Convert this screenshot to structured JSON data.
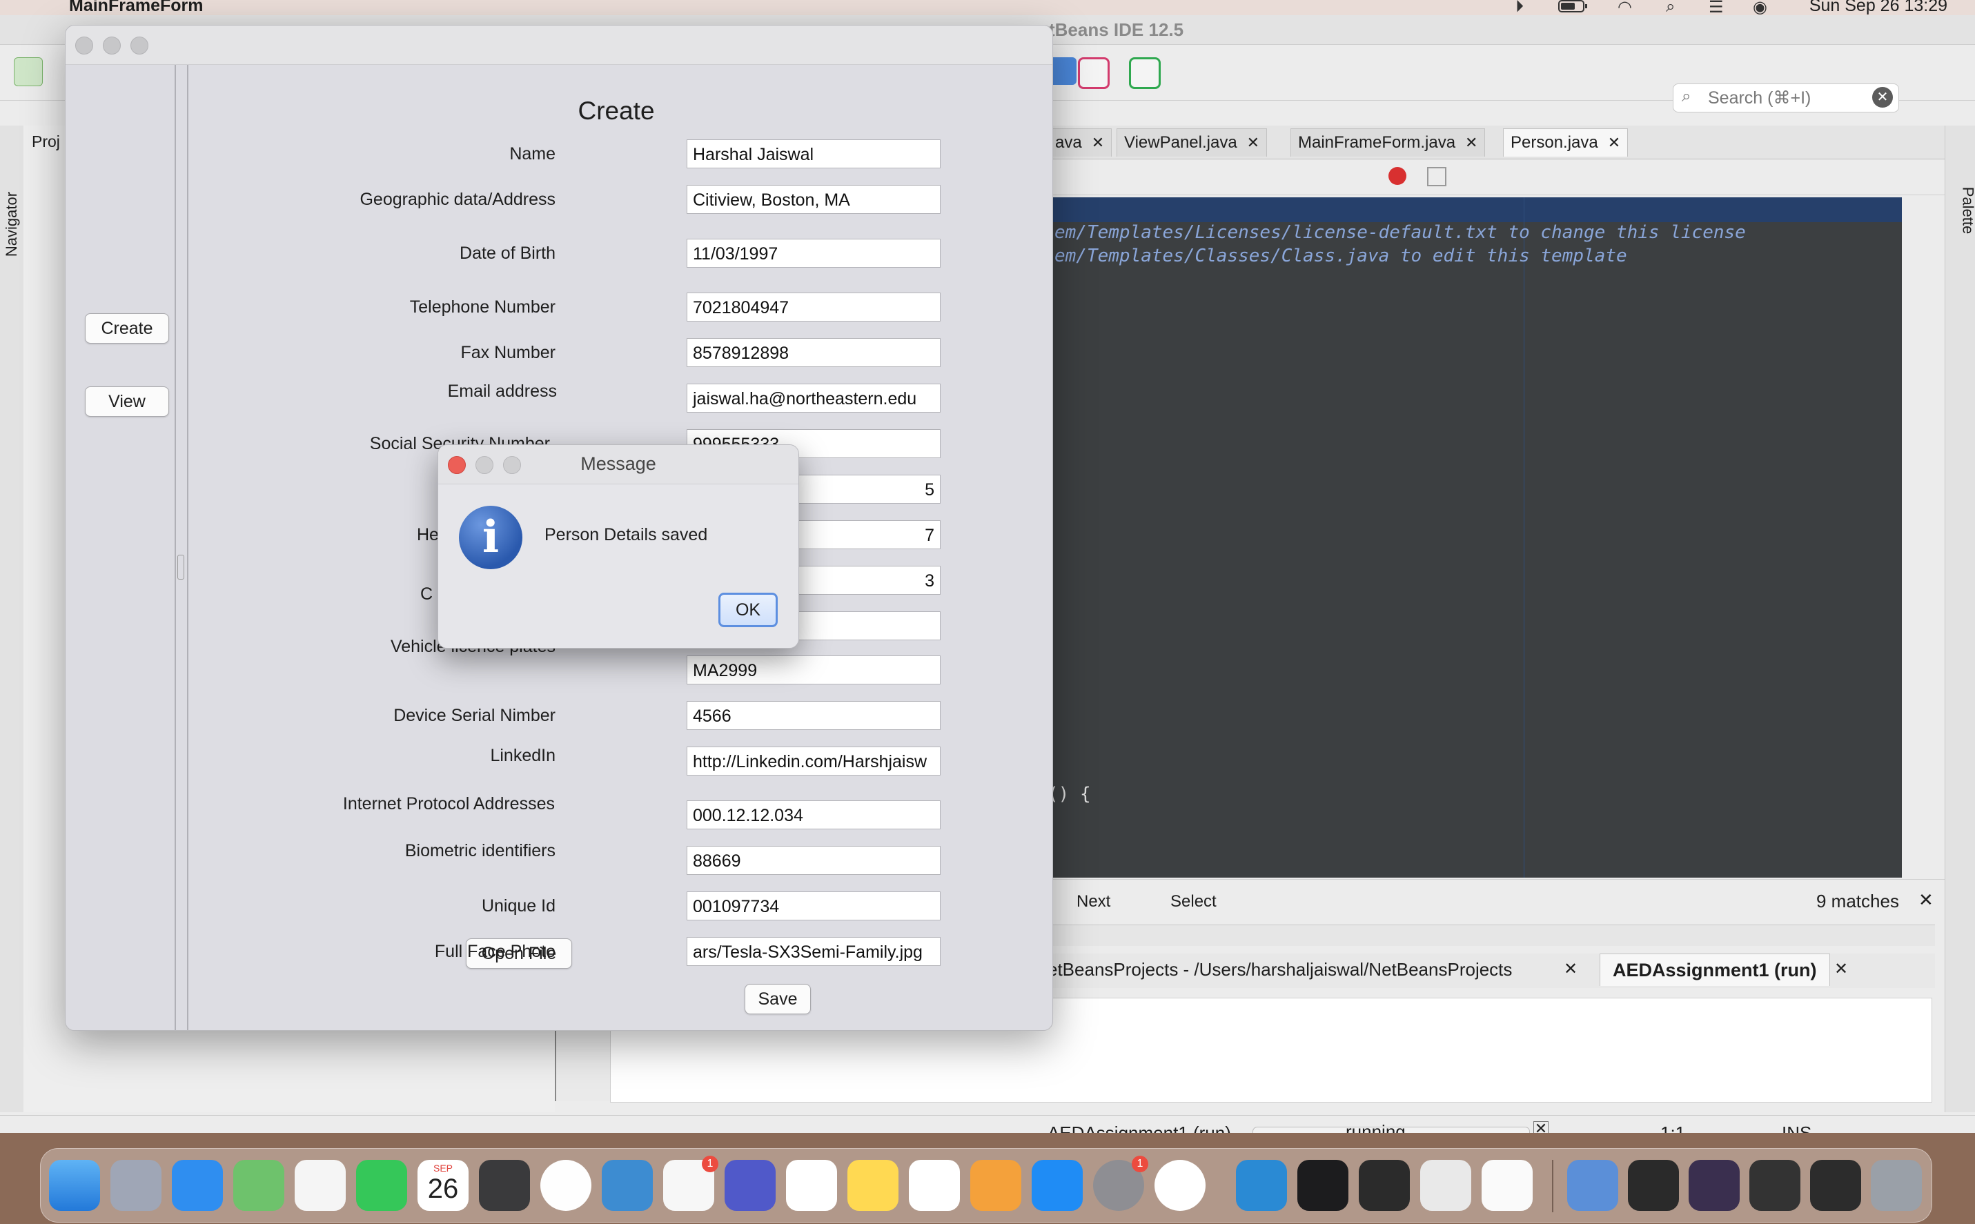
{
  "menubar": {
    "app_name": "MainFrameForm",
    "clock": "Sun Sep 26  13:29",
    "icons": [
      "apple-icon",
      "play-icon",
      "battery-icon",
      "wifi-icon",
      "search-icon",
      "control-center-icon",
      "siri-icon"
    ]
  },
  "ide": {
    "title": "tBeans IDE 12.5",
    "search_placeholder": "Search (⌘+I)",
    "left_panel_label": "Proj",
    "navigator_label": "Navigator",
    "palette_label": "Palette",
    "editor_tabs": [
      {
        "label": "ava"
      },
      {
        "label": "ViewPanel.java"
      },
      {
        "label": "MainFrameForm.java"
      },
      {
        "label": "Person.java"
      }
    ],
    "code_lines": [
      "em/Templates/Licenses/license-default.txt to change this license",
      "em/Templates/Classes/Class.java to edit this template",
      "() {"
    ],
    "findbar": {
      "next": "Next",
      "select": "Select",
      "matches": "9 matches"
    },
    "output_tabs": [
      {
        "label": "etBeansProjects - /Users/harshaljaiswal/NetBeansProjects"
      },
      {
        "label": "AEDAssignment1 (run)"
      }
    ],
    "status": {
      "task": "AEDAssignment1 (run)",
      "running": "running...",
      "position": "1:1",
      "mode": "INS"
    }
  },
  "form_window": {
    "nav_buttons": {
      "create": "Create",
      "view": "View"
    },
    "title": "Create",
    "fields": [
      {
        "label": "Name",
        "value": "Harshal Jaiswal"
      },
      {
        "label": "Geographic data/Address",
        "value": "Citiview, Boston, MA"
      },
      {
        "label": "Date of Birth",
        "value": "11/03/1997"
      },
      {
        "label": "Telephone Number",
        "value": "7021804947"
      },
      {
        "label": "Fax Number",
        "value": "8578912898"
      },
      {
        "label": "Email address",
        "value": "jaiswal.ha@northeastern.edu"
      },
      {
        "label": "Social Security Number",
        "value": "999555333"
      },
      {
        "label": "",
        "value": "5"
      },
      {
        "label": "He",
        "value": "7"
      },
      {
        "label": "",
        "value": "3"
      },
      {
        "label": "C",
        "value": ""
      },
      {
        "label": "Vehicle licence plates",
        "value": "MA2999"
      },
      {
        "label": "Device Serial Nimber",
        "value": "4566"
      },
      {
        "label": "LinkedIn",
        "value": "http://Linkedin.com/Harshjaisw"
      },
      {
        "label": "Internet Protocol Addresses",
        "value": "000.12.12.034"
      },
      {
        "label": "Biometric identifiers",
        "value": "88669"
      },
      {
        "label": "Unique Id",
        "value": "001097734"
      },
      {
        "label": "Full Face Photo",
        "value": "ars/Tesla-SX3Semi-Family.jpg"
      }
    ],
    "open_file_button": "Open File",
    "save_button": "Save"
  },
  "dialog": {
    "title": "Message",
    "message": "Person Details saved",
    "ok_button": "OK",
    "icon": "info-icon"
  },
  "dock": {
    "calendar_month": "SEP",
    "calendar_day": "26",
    "badges": {
      "slack": "1",
      "system_prefs": "1"
    }
  },
  "colors": {
    "accent": "#5d8fe0",
    "editor_bg": "#3c3f41",
    "dialog_info": "#2a59ad",
    "close_red": "#ec5f57"
  }
}
